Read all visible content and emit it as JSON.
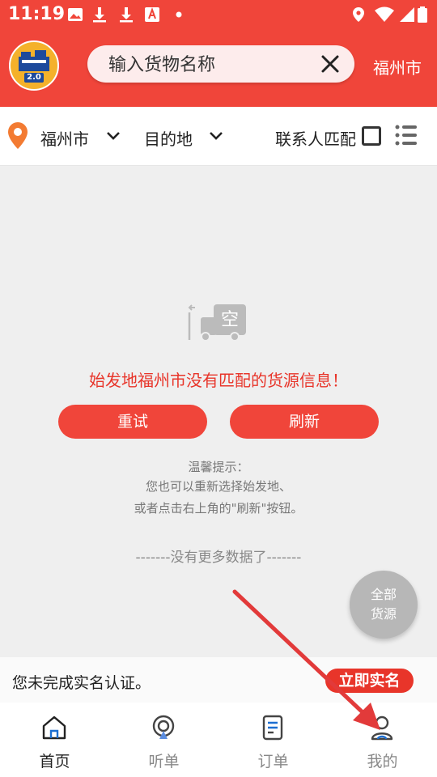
{
  "status_bar": {
    "time": "11:19"
  },
  "header": {
    "logo_text": "2.0",
    "search_placeholder": "输入货物名称",
    "city": "福州市"
  },
  "filters": {
    "origin": "福州市",
    "destination": "目的地",
    "contact_match": "联系人匹配"
  },
  "empty_state": {
    "badge": "空",
    "message": "始发地福州市没有匹配的货源信息！",
    "retry_label": "重试",
    "refresh_label": "刷新",
    "tip_title": "温馨提示：",
    "tip_line1": "您也可以重新选择始发地、",
    "tip_line2": "或者点击右上角的\"刷新\"按钮。"
  },
  "no_more": "-------没有更多数据了-------",
  "fab": {
    "line1": "全部",
    "line2": "货源"
  },
  "notice": {
    "text": "您未完成实名认证。",
    "button": "立即实名"
  },
  "tabs": [
    {
      "label": "首页",
      "icon": "home-icon",
      "active": true
    },
    {
      "label": "听单",
      "icon": "listen-icon",
      "active": false
    },
    {
      "label": "订单",
      "icon": "order-icon",
      "active": false
    },
    {
      "label": "我的",
      "icon": "profile-icon",
      "active": false
    }
  ],
  "colors": {
    "brand_red": "#f0453a",
    "alert_red": "#e8352a",
    "fab_gray": "#b7b7b7"
  }
}
